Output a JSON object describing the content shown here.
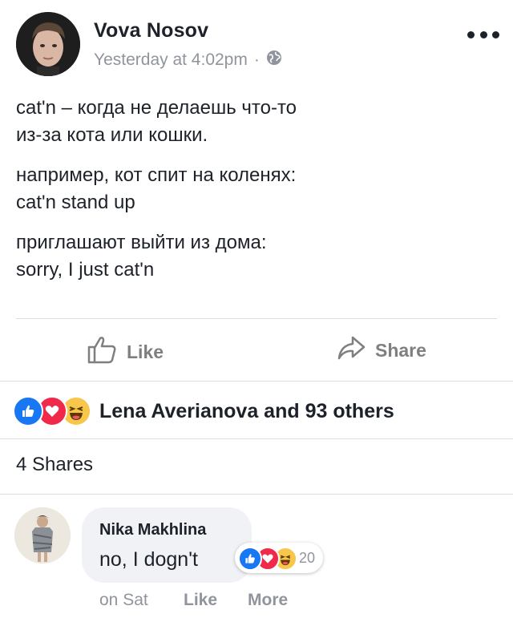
{
  "post": {
    "author": "Vova Nosov",
    "timestamp": "Yesterday at 4:02pm",
    "separator": "·",
    "privacy_icon": "globe-icon",
    "paragraphs": [
      [
        "cat'n – когда не делаешь что-то",
        "из-за кота или кошки."
      ],
      [
        "например, кот спит на коленях:",
        "cat'n stand up"
      ],
      [
        "приглашают выйти из дома:",
        "sorry, I just cat'n"
      ]
    ]
  },
  "actions": {
    "like_label": "Like",
    "share_label": "Share"
  },
  "reactions": {
    "icons": [
      "like-reaction-icon",
      "love-reaction-icon",
      "haha-reaction-icon"
    ],
    "summary": "Lena Averianova and 93 others"
  },
  "shares": {
    "label": "4 Shares"
  },
  "comment": {
    "author": "Nika Makhlina",
    "text": "no, I dogn't",
    "reaction_count": "20",
    "time": "on Sat",
    "like_label": "Like",
    "more_label": "More"
  },
  "colors": {
    "accent_blue": "#1877f2",
    "love_red": "#f0284a",
    "haha_yellow": "#f7c64a",
    "meta_gray": "#90949c"
  }
}
